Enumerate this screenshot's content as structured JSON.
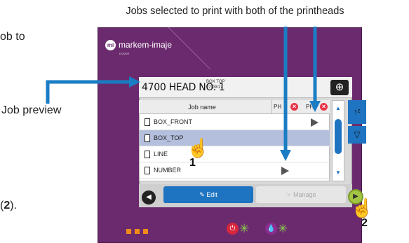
{
  "annotations": {
    "top_callout": "Jobs selected to print with both of the printheads",
    "left_callout": "Job preview",
    "fragment_top": "ob to",
    "fragment_bottom_open": "(",
    "fragment_bottom_num": "2",
    "fragment_bottom_close": ")."
  },
  "device": {
    "brand": "markem-imaje",
    "brand_sub": "DOVER"
  },
  "header": {
    "job_title": "4700 HEAD NO. 1",
    "preview_line1": "BOX TOP",
    "preview_line2": "27/09/17"
  },
  "table": {
    "col_name": "Job name",
    "col_ph1": "PH",
    "col_ph2": "PH",
    "rows": [
      {
        "name": "BOX_FRONT",
        "selected": false,
        "ph2": true
      },
      {
        "name": "BOX_TOP",
        "selected": true
      },
      {
        "name": "LINE",
        "selected": false
      },
      {
        "name": "NUMBER",
        "selected": false,
        "ph1": true
      }
    ]
  },
  "buttons": {
    "edit": "Edit",
    "manage": "Manage"
  },
  "steps": {
    "step1": "1",
    "step2": "2"
  },
  "colors": {
    "device": "#6b2a6e",
    "accent_blue": "#1e74c0",
    "selected_row": "#b3bfdd",
    "play_green": "#a4c743",
    "callout_arrow": "#1a7dc4"
  }
}
